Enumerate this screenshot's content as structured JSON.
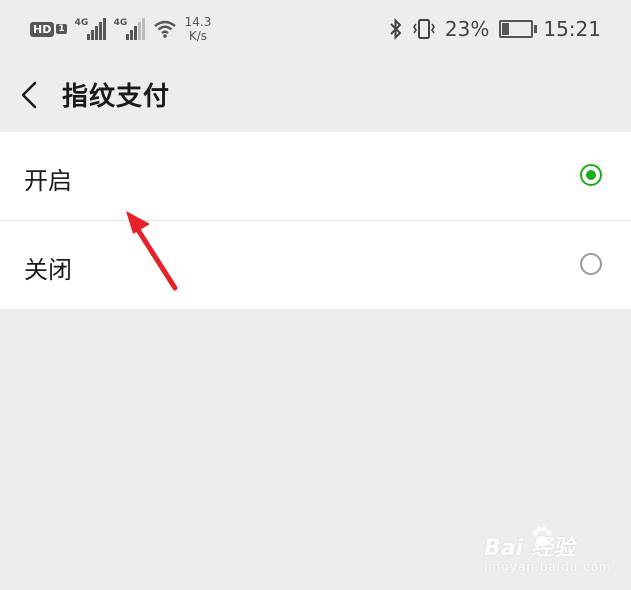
{
  "status_bar": {
    "hd_label": "HD",
    "hd_sim": "1",
    "net1": "4G",
    "net2": "4G",
    "speed_value": "14.3",
    "speed_unit": "K/s",
    "battery": "23%",
    "battery_level": 0.23,
    "time": "15:21"
  },
  "nav": {
    "title": "指纹支付"
  },
  "options": [
    {
      "label": "开启",
      "selected": true
    },
    {
      "label": "关闭",
      "selected": false
    }
  ],
  "annotation": {
    "arrow_color": "#e8202a"
  },
  "watermark": {
    "brand": "Bai  经验",
    "url": "jingyan.baidu.com"
  },
  "colors": {
    "accent_green": "#1aad19",
    "page_bg": "#ededed"
  }
}
